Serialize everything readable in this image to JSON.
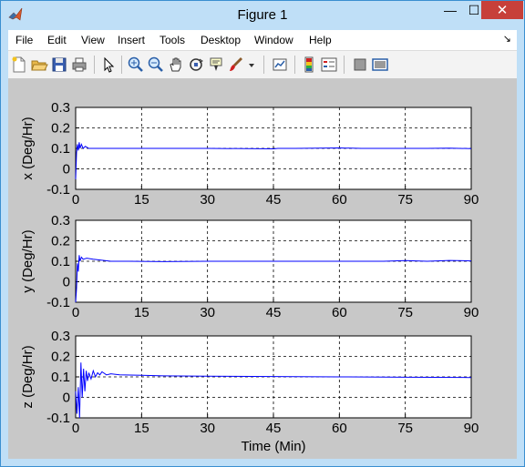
{
  "window": {
    "title": "Figure 1",
    "minimize_glyph": "—",
    "maximize_glyph": "☐",
    "close_glyph": "✕"
  },
  "menu": {
    "items": [
      "File",
      "Edit",
      "View",
      "Insert",
      "Tools",
      "Desktop",
      "Window",
      "Help"
    ],
    "dock_glyph": "↘"
  },
  "toolbar": {
    "icons": [
      "new-figure-icon",
      "open-file-icon",
      "save-figure-icon",
      "print-figure-icon",
      "edit-plot-arrow-icon",
      "zoom-in-icon",
      "zoom-out-icon",
      "pan-hand-icon",
      "rotate-3d-icon",
      "data-cursor-icon",
      "brush-icon",
      "brush-dropdown-icon",
      "link-plot-icon",
      "insert-colorbar-icon",
      "insert-legend-icon",
      "hide-plot-tools-icon",
      "show-plot-tools-icon"
    ]
  },
  "colors": {
    "line": "#0000ff",
    "figure_bg": "#c8c8c8",
    "axes_bg": "#ffffff",
    "title_bar": "#bfdff7",
    "close_button": "#c7403a"
  },
  "chart_data": [
    {
      "type": "line",
      "ylabel": "x (Deg/Hr)",
      "xlabel": "",
      "xlim": [
        0,
        90
      ],
      "ylim": [
        -0.1,
        0.3
      ],
      "xticks": [
        "0",
        "15",
        "30",
        "45",
        "60",
        "75",
        "90"
      ],
      "yticks": [
        "-0.1",
        "0",
        "0.1",
        "0.2",
        "0.3"
      ],
      "grid": true,
      "series": [
        {
          "x": [
            0,
            0.2,
            0.4,
            0.6,
            0.8,
            1.0,
            1.3,
            1.7,
            2.2,
            3,
            5,
            10,
            20,
            30,
            45,
            46,
            50,
            60,
            65,
            75,
            80,
            85,
            90
          ],
          "y": [
            -0.05,
            0.08,
            0.12,
            0.09,
            0.13,
            0.1,
            0.12,
            0.1,
            0.11,
            0.1,
            0.1,
            0.1,
            0.1,
            0.1,
            0.098,
            0.1,
            0.1,
            0.102,
            0.1,
            0.1,
            0.1,
            0.101,
            0.099
          ]
        }
      ]
    },
    {
      "type": "line",
      "ylabel": "y (Deg/Hr)",
      "xlabel": "",
      "xlim": [
        0,
        90
      ],
      "ylim": [
        -0.1,
        0.3
      ],
      "xticks": [
        "0",
        "15",
        "30",
        "45",
        "60",
        "75",
        "90"
      ],
      "yticks": [
        "-0.1",
        "0",
        "0.1",
        "0.2",
        "0.3"
      ],
      "grid": true,
      "series": [
        {
          "x": [
            0,
            0.2,
            0.4,
            0.6,
            0.8,
            1.0,
            1.3,
            1.7,
            2.5,
            4,
            6,
            8,
            12,
            20,
            30,
            45,
            60,
            70,
            75,
            80,
            85,
            90
          ],
          "y": [
            -0.1,
            -0.03,
            0.09,
            0.05,
            0.13,
            0.1,
            0.12,
            0.11,
            0.115,
            0.11,
            0.105,
            0.1,
            0.1,
            0.098,
            0.1,
            0.1,
            0.1,
            0.1,
            0.103,
            0.1,
            0.104,
            0.102
          ]
        }
      ]
    },
    {
      "type": "line",
      "ylabel": "z (Deg/Hr)",
      "xlabel": "Time (Min)",
      "xlim": [
        0,
        90
      ],
      "ylim": [
        -0.1,
        0.3
      ],
      "xticks": [
        "0",
        "15",
        "30",
        "45",
        "60",
        "75",
        "90"
      ],
      "yticks": [
        "-0.1",
        "0",
        "0.1",
        "0.2",
        "0.3"
      ],
      "grid": true,
      "series": [
        {
          "x": [
            0,
            0.3,
            0.6,
            0.9,
            1.2,
            1.5,
            1.8,
            2.1,
            2.4,
            2.7,
            3,
            3.5,
            4,
            4.5,
            5,
            5.5,
            6,
            7,
            8,
            10,
            15,
            20,
            30,
            45,
            60,
            75,
            90
          ],
          "y": [
            0.03,
            -0.08,
            0.05,
            -0.1,
            0.17,
            0.0,
            0.14,
            0.03,
            0.13,
            0.08,
            0.12,
            0.09,
            0.13,
            0.1,
            0.12,
            0.11,
            0.125,
            0.11,
            0.115,
            0.11,
            0.108,
            0.105,
            0.103,
            0.102,
            0.1,
            0.098,
            0.097
          ]
        }
      ]
    }
  ]
}
